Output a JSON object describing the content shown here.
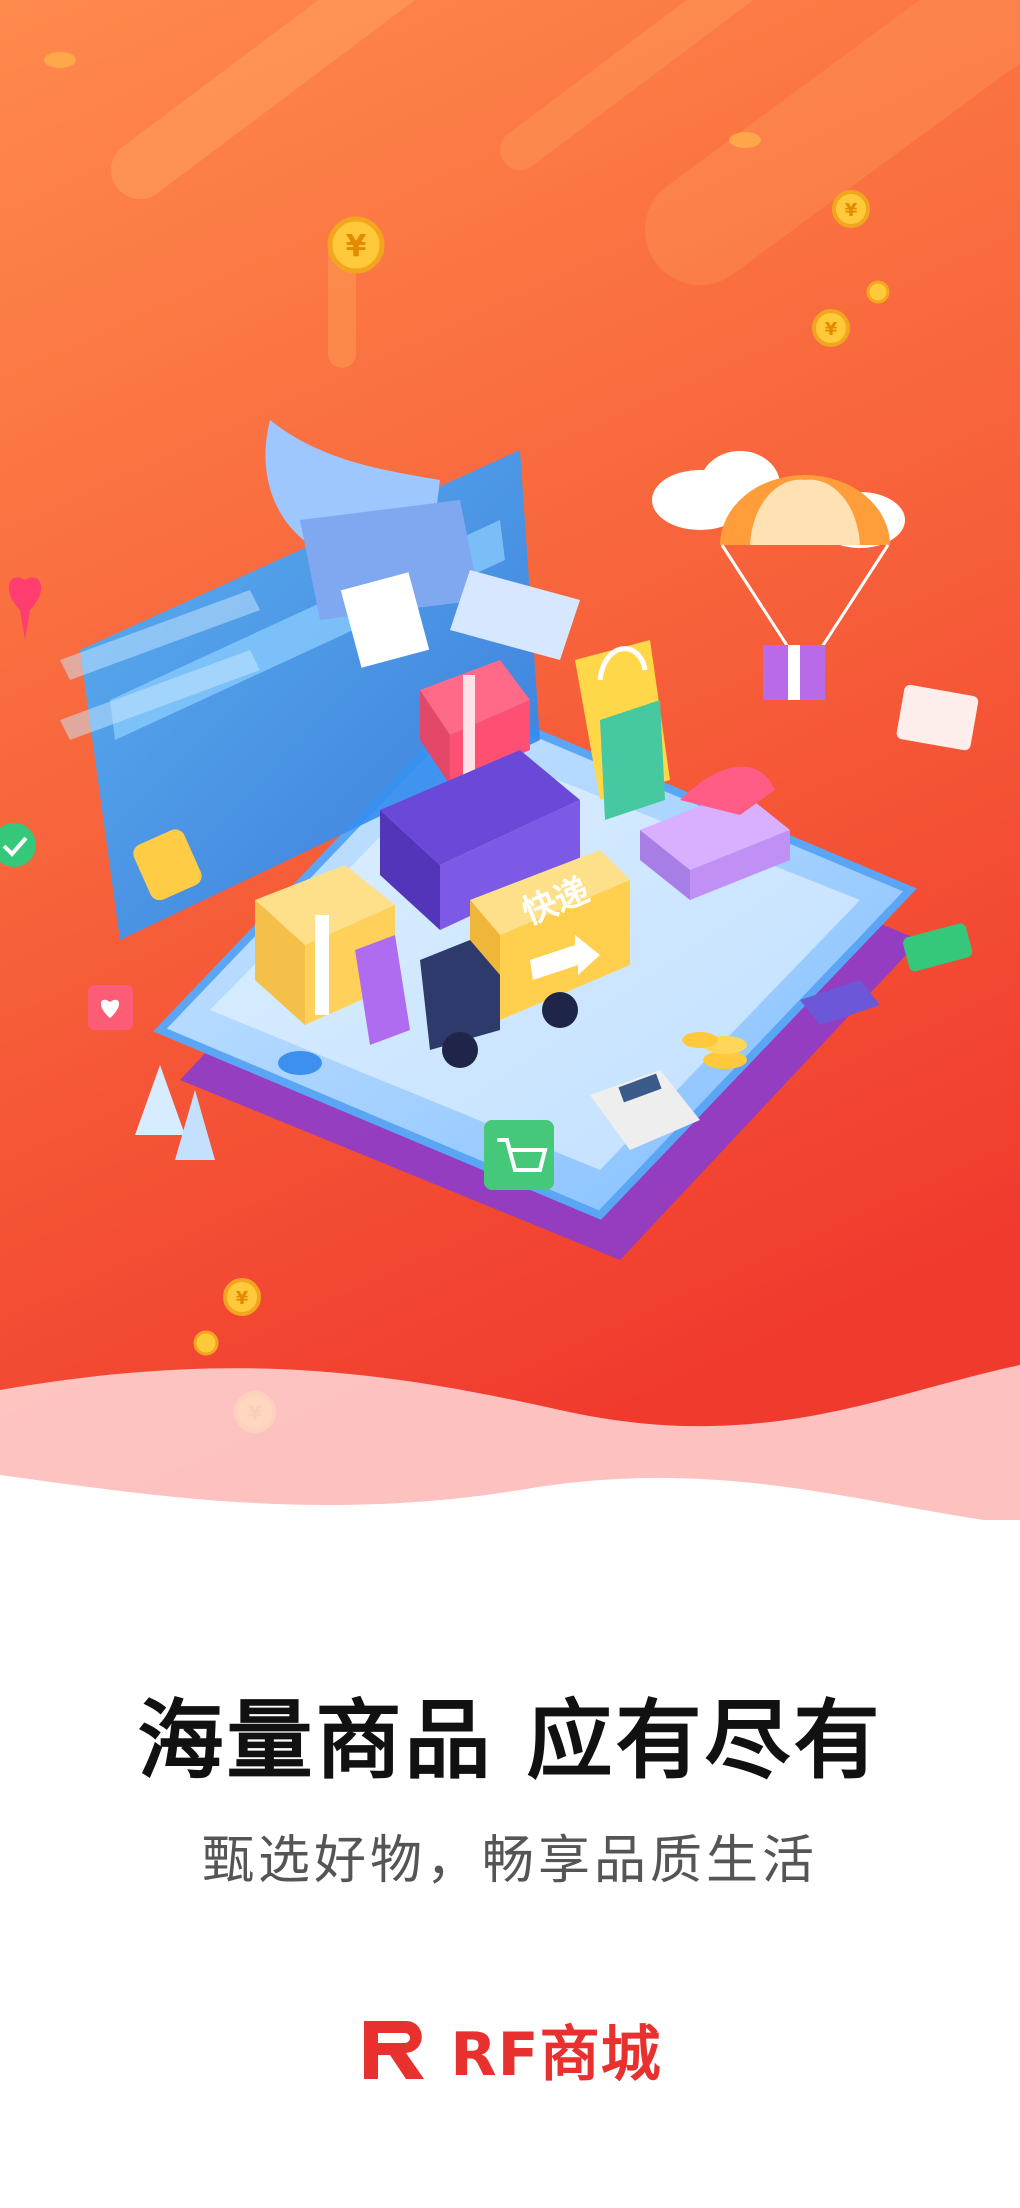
{
  "hero": {
    "illustration": "online-shopping-splash-illustration",
    "delivery_truck_label": "快递",
    "coin_glyph": "¥"
  },
  "headline": "海量商品 应有尽有",
  "subline": "甄选好物，畅享品质生活",
  "brand": {
    "logo_icon": "rf-logo-icon",
    "name": "RF商城"
  },
  "colors": {
    "accent": "#e8312f",
    "hero_top": "#ff8a4c",
    "hero_bottom": "#f03a2e"
  }
}
